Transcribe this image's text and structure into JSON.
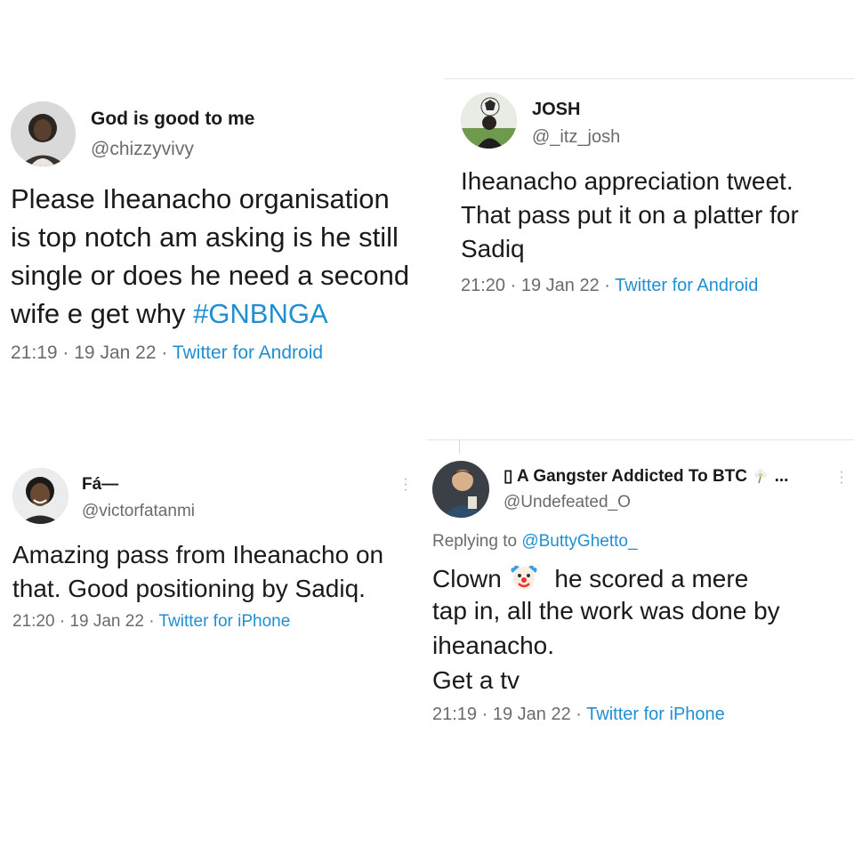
{
  "tweets": [
    {
      "display_name": "God is good to me",
      "handle": "@chizzyvivy",
      "lines": [
        "Please Iheanacho organisation",
        "is top notch am asking is he still",
        "single or does he need a second",
        "wife e get why"
      ],
      "hashtag": "#GNBNGA",
      "time": "21:19",
      "date": "19 Jan 22",
      "source": "Twitter for Android"
    },
    {
      "display_name": "JOSH",
      "handle": "@_itz_josh",
      "lines": [
        "Iheanacho appreciation tweet.",
        "That pass put it on a platter for",
        "Sadiq"
      ],
      "time": "21:20",
      "date": "19 Jan 22",
      "source": "Twitter for Android"
    },
    {
      "display_name": "Fá—",
      "handle": "@victorfatanmi",
      "lines": [
        "Amazing pass from Iheanacho on",
        "that. Good positioning by Sadiq."
      ],
      "time": "21:20",
      "date": "19 Jan 22",
      "source": "Twitter for iPhone"
    },
    {
      "display_name": "▯ A Gangster Addicted To BTC",
      "name_suffix": "...",
      "handle": "@Undefeated_O",
      "replying_prefix": "Replying to",
      "replying_to": "@ButtyGhetto_",
      "line1_a": "Clown",
      "line1_b": "he scored a mere",
      "lines": [
        "tap in, all the work was done by",
        "iheanacho.",
        "Get a tv"
      ],
      "time": "21:19",
      "date": "19 Jan 22",
      "source": "Twitter for iPhone"
    }
  ],
  "meta_separator": "·",
  "colors": {
    "link": "#1f8fd1",
    "secondary_text": "#6b6b6b",
    "primary_text": "#1a1a1a",
    "divider": "#e4e4e4"
  }
}
